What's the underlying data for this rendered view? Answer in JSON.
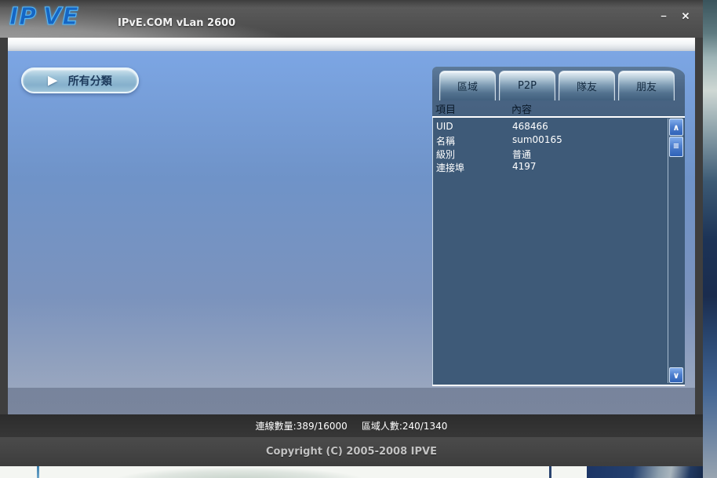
{
  "window": {
    "logo_ip": "IP",
    "logo_ve": "VE",
    "title": "IPvE.COM vLan 2600"
  },
  "icons": {
    "minimize": "−",
    "close": "✕",
    "play": "▶",
    "scroll_up": "∧",
    "scroll_down": "∨",
    "thumb_grip": "≡"
  },
  "toolbar": {
    "all_categories_label": "所有分類"
  },
  "panel": {
    "tabs": [
      {
        "label": "區域"
      },
      {
        "label": "P2P"
      },
      {
        "label": "隊友"
      },
      {
        "label": "朋友"
      }
    ],
    "table": {
      "columns": [
        "項目",
        "內容"
      ],
      "rows": [
        {
          "item": "UID",
          "value": "468466"
        },
        {
          "item": "名稱",
          "value": "sum00165"
        },
        {
          "item": "級別",
          "value": "普通"
        },
        {
          "item": "連接埠",
          "value": "4197"
        }
      ]
    }
  },
  "status_bar": {
    "connections": "連線數量:389/16000",
    "region_count": "區域人數:240/1340"
  },
  "footer": {
    "copyright": "Copyright (C) 2005-2008 IPVE"
  },
  "colors": {
    "titlebar_gray": "#565656",
    "content_blue_top": "#7ca6e4",
    "content_blue_bottom": "#9aa7bf",
    "panel_header": "#4a6585",
    "panel_body": "#3e5a78",
    "scroll_button_blue": "#3f74c8",
    "status_bar_bg": "#333333",
    "footer_bg": "#444444",
    "logo_blue": "#1566c4",
    "logo_outline": "#57b8f6"
  }
}
